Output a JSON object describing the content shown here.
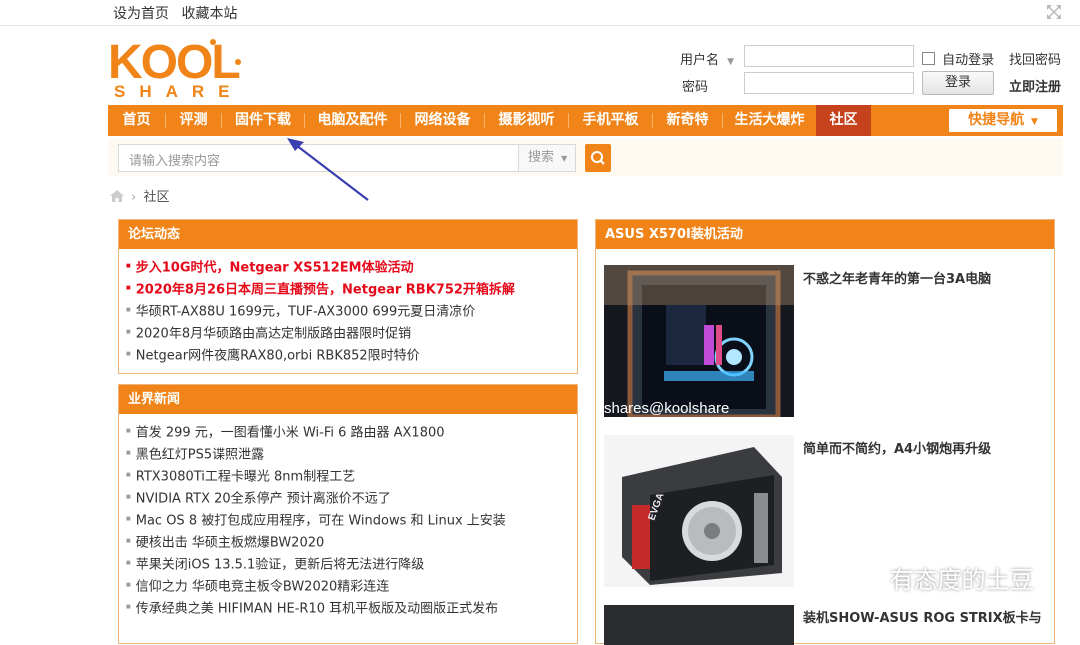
{
  "topbar": {
    "set_home": "设为首页",
    "bookmark": "收藏本站"
  },
  "logo": {
    "top": "KOOL",
    "bottom": "SHARE"
  },
  "login": {
    "username_label": "用户名",
    "password_label": "密码",
    "auto_login": "自动登录",
    "recover": "找回密码",
    "login_button": "登录",
    "register": "立即注册"
  },
  "nav": {
    "items": [
      "首页",
      "评测",
      "固件下载",
      "电脑及配件",
      "网络设备",
      "摄影视听",
      "手机平板",
      "新奇特",
      "生活大爆炸",
      "社区"
    ],
    "quick": "快捷导航"
  },
  "search": {
    "placeholder": "请输入搜索内容",
    "type": "搜索"
  },
  "breadcrumb": {
    "current": "社区"
  },
  "forum": {
    "title": "论坛动态",
    "items": [
      "步入10G时代，Netgear XS512EM体验活动",
      "2020年8月26日本周三直播预告，Netgear RBK752开箱拆解",
      "华硕RT-AX88U 1699元，TUF-AX3000 699元夏日清凉价",
      "2020年8月华硕路由高达定制版路由器限时促销",
      "Netgear网件夜鹰RAX80,orbi RBK852限时特价"
    ]
  },
  "news": {
    "title": "业界新闻",
    "items": [
      "首发 299 元，一图看懂小米 Wi-Fi 6 路由器 AX1800",
      "黑色红灯PS5谍照泄露",
      "RTX3080Ti工程卡曝光 8nm制程工艺",
      "NVIDIA RTX 20全系停产 预计离涨价不远了",
      "Mac OS 8 被打包成应用程序，可在 Windows 和 Linux 上安装",
      "硬核出击 华硕主板燃爆BW2020",
      "苹果关闭iOS 13.5.1验证，更新后将无法进行降级",
      "信仰之力 华硕电竞主板令BW2020精彩连连",
      "传承经典之美 HIFIMAN HE-R10 耳机平板版及动圈版正式发布"
    ]
  },
  "event": {
    "title": "ASUS X570I装机活动",
    "posts": [
      {
        "title": "不惑之年老青年的第一台3A电脑",
        "caption": "shares@koolshare"
      },
      {
        "title": "简单而不简约，A4小钢炮再升级"
      },
      {
        "title": "装机SHOW-ASUS ROG STRIX板卡与"
      }
    ]
  },
  "watermark": {
    "text": "有态度的土豆"
  },
  "colors": {
    "accent": "#f08418",
    "active": "#c5421d",
    "red_link": "#e5091a"
  }
}
